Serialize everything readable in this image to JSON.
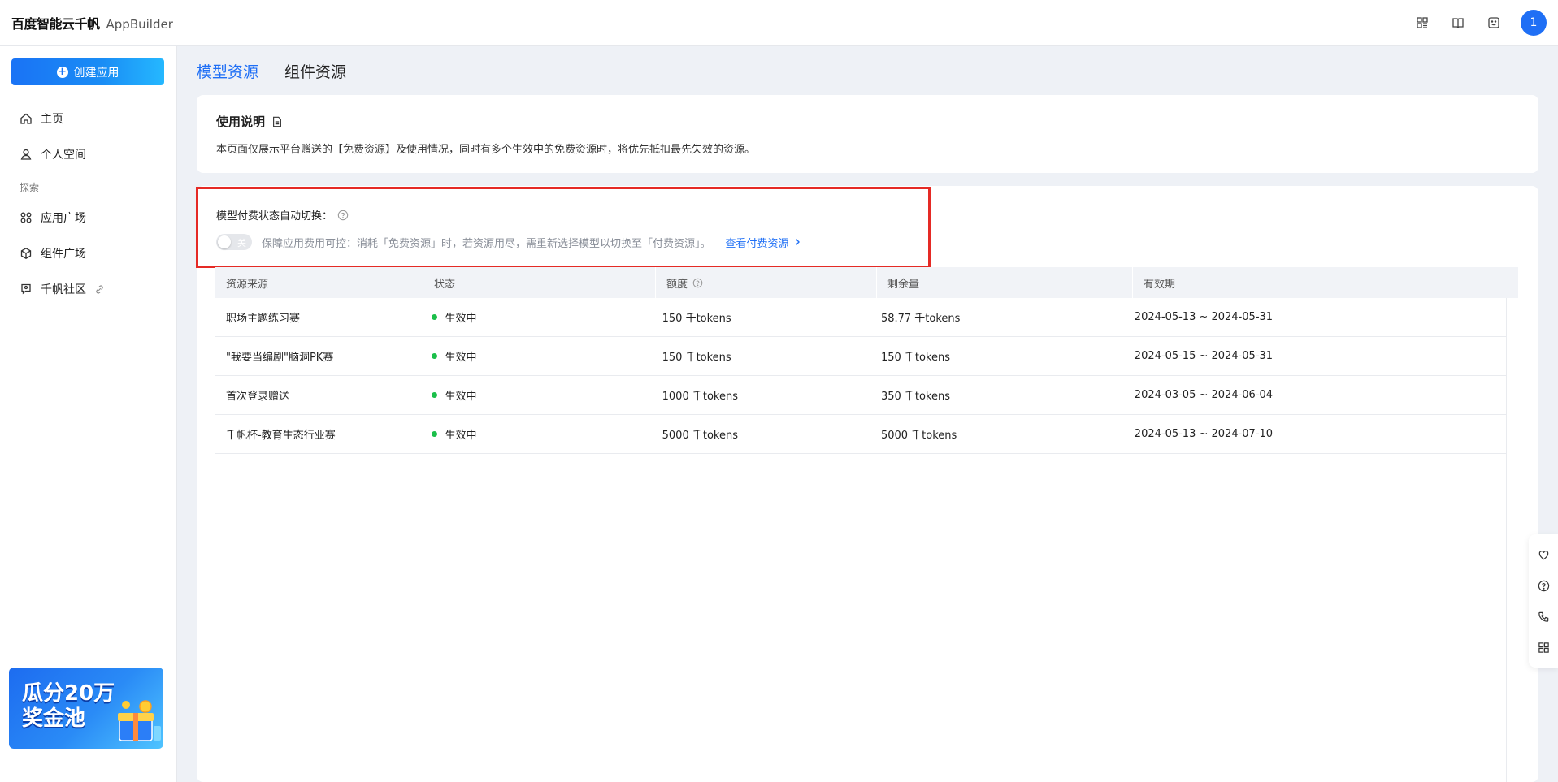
{
  "header": {
    "brand_main": "百度智能云千帆",
    "brand_sub": "AppBuilder",
    "icons": [
      "grid-icon",
      "book-icon",
      "feedback-icon"
    ],
    "avatar_text": "1"
  },
  "sidebar": {
    "create_label": "创建应用",
    "items": [
      {
        "label": "主页",
        "icon": "home-icon"
      },
      {
        "label": "个人空间",
        "icon": "user-icon"
      }
    ],
    "section_label": "探索",
    "explore_items": [
      {
        "label": "应用广场",
        "icon": "apps-icon"
      },
      {
        "label": "组件广场",
        "icon": "component-icon"
      },
      {
        "label": "千帆社区",
        "icon": "community-icon"
      }
    ],
    "promo": {
      "line1": "瓜分20万",
      "line2": "奖金池"
    }
  },
  "tabs": [
    {
      "label": "模型资源",
      "active": true
    },
    {
      "label": "组件资源",
      "active": false
    }
  ],
  "usage": {
    "title": "使用说明",
    "description": "本页面仅展示平台赠送的【免费资源】及使用情况，同时有多个生效中的免费资源时，将优先抵扣最先失效的资源。"
  },
  "switch": {
    "title": "模型付费状态自动切换：",
    "toggle_label": "关",
    "toggle_on": false,
    "description": "保障应用费用可控：消耗「免费资源」时，若资源用尽，需重新选择模型以切换至「付费资源」。",
    "link_label": "查看付费资源"
  },
  "table": {
    "columns": [
      "资源来源",
      "状态",
      "额度",
      "剩余量",
      "有效期"
    ],
    "rows": [
      {
        "source": "职场主题练习赛",
        "status": "生效中",
        "quota": "150 千tokens",
        "remaining": "58.77 千tokens",
        "validity": "2024-05-13 ~ 2024-05-31"
      },
      {
        "source": "\"我要当编剧\"脑洞PK赛",
        "status": "生效中",
        "quota": "150 千tokens",
        "remaining": "150 千tokens",
        "validity": "2024-05-15 ~ 2024-05-31"
      },
      {
        "source": "首次登录赠送",
        "status": "生效中",
        "quota": "1000 千tokens",
        "remaining": "350 千tokens",
        "validity": "2024-03-05 ~ 2024-06-04"
      },
      {
        "source": "千帆杯-教育生态行业赛",
        "status": "生效中",
        "quota": "5000 千tokens",
        "remaining": "5000 千tokens",
        "validity": "2024-05-13 ~ 2024-07-10"
      }
    ]
  },
  "colors": {
    "accent": "#1f6ff5",
    "status_active": "#1bbf4a",
    "highlight": "#e52a25"
  }
}
